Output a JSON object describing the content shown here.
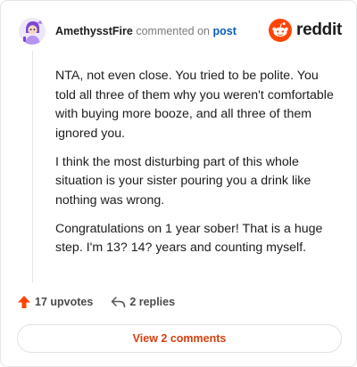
{
  "header": {
    "username": "AmethysstFire",
    "action_text": "commented on",
    "post_link": "post"
  },
  "brand": {
    "name": "reddit",
    "icon": "reddit-alien-icon",
    "color": "#ff4500"
  },
  "comment": {
    "paragraphs": [
      "NTA, not even close. You tried to be polite. You told all three of them why you weren't comfortable with buying more booze, and all three of them ignored you.",
      "I think the most disturbing part of this whole situation is your sister pouring you a drink like nothing was wrong.",
      "Congratulations on 1 year sober! That is a huge step. I'm 13? 14? years and counting myself."
    ]
  },
  "actions": {
    "upvotes": "17 upvotes",
    "upvote_icon": "upvote-arrow-icon",
    "upvote_color": "#ff4500",
    "replies": "2 replies",
    "reply_icon": "reply-arrow-icon"
  },
  "view_button": {
    "label": "View 2 comments",
    "color": "#d6400f"
  }
}
